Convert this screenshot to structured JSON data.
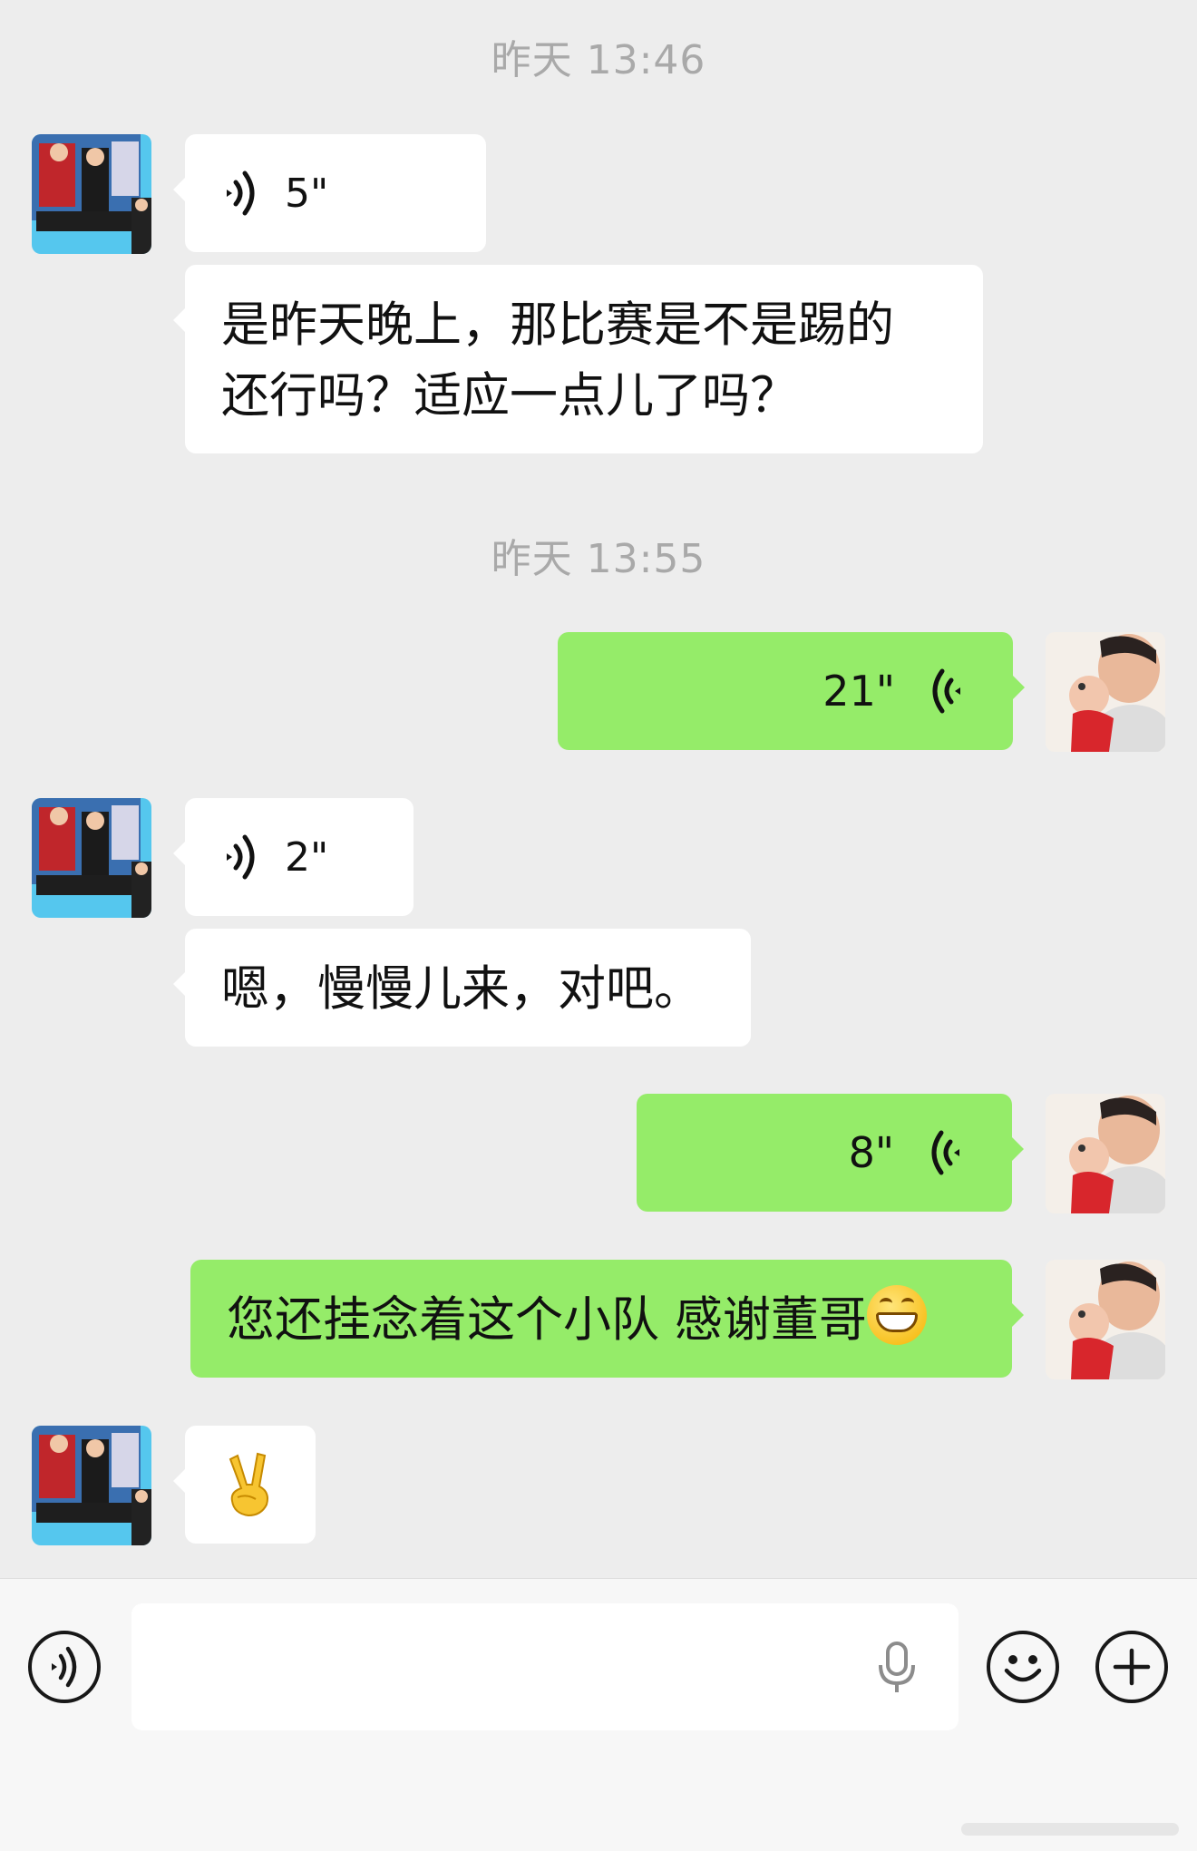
{
  "messages": [
    {
      "type": "timestamp",
      "text": "昨天 13:46"
    },
    {
      "type": "voice",
      "direction": "incoming",
      "duration": "5\""
    },
    {
      "type": "text",
      "direction": "incoming",
      "lines": [
        "是昨天晚上，那比赛是不是踢的",
        "还行吗？适应一点儿了吗？"
      ]
    },
    {
      "type": "timestamp",
      "text": "昨天 13:55"
    },
    {
      "type": "voice",
      "direction": "outgoing",
      "duration": "21\""
    },
    {
      "type": "voice",
      "direction": "incoming",
      "duration": "2\""
    },
    {
      "type": "text",
      "direction": "incoming",
      "text": "嗯，慢慢儿来，对吧。"
    },
    {
      "type": "voice",
      "direction": "outgoing",
      "duration": "8\""
    },
    {
      "type": "text",
      "direction": "outgoing",
      "text": "您还挂念着这个小队 感谢董哥",
      "emoji": "grinning-face"
    },
    {
      "type": "emoji",
      "direction": "incoming",
      "emoji": "victory-hand"
    }
  ],
  "input_bar": {
    "voice_toggle_icon": "voice-mode-icon",
    "input_value": "",
    "mic_icon": "microphone-icon",
    "emoji_icon": "smiley-icon",
    "more_icon": "plus-icon"
  },
  "colors": {
    "background": "#ededed",
    "incoming_bubble": "#ffffff",
    "outgoing_bubble": "#95ec69",
    "timestamp": "#a9a9a9"
  }
}
